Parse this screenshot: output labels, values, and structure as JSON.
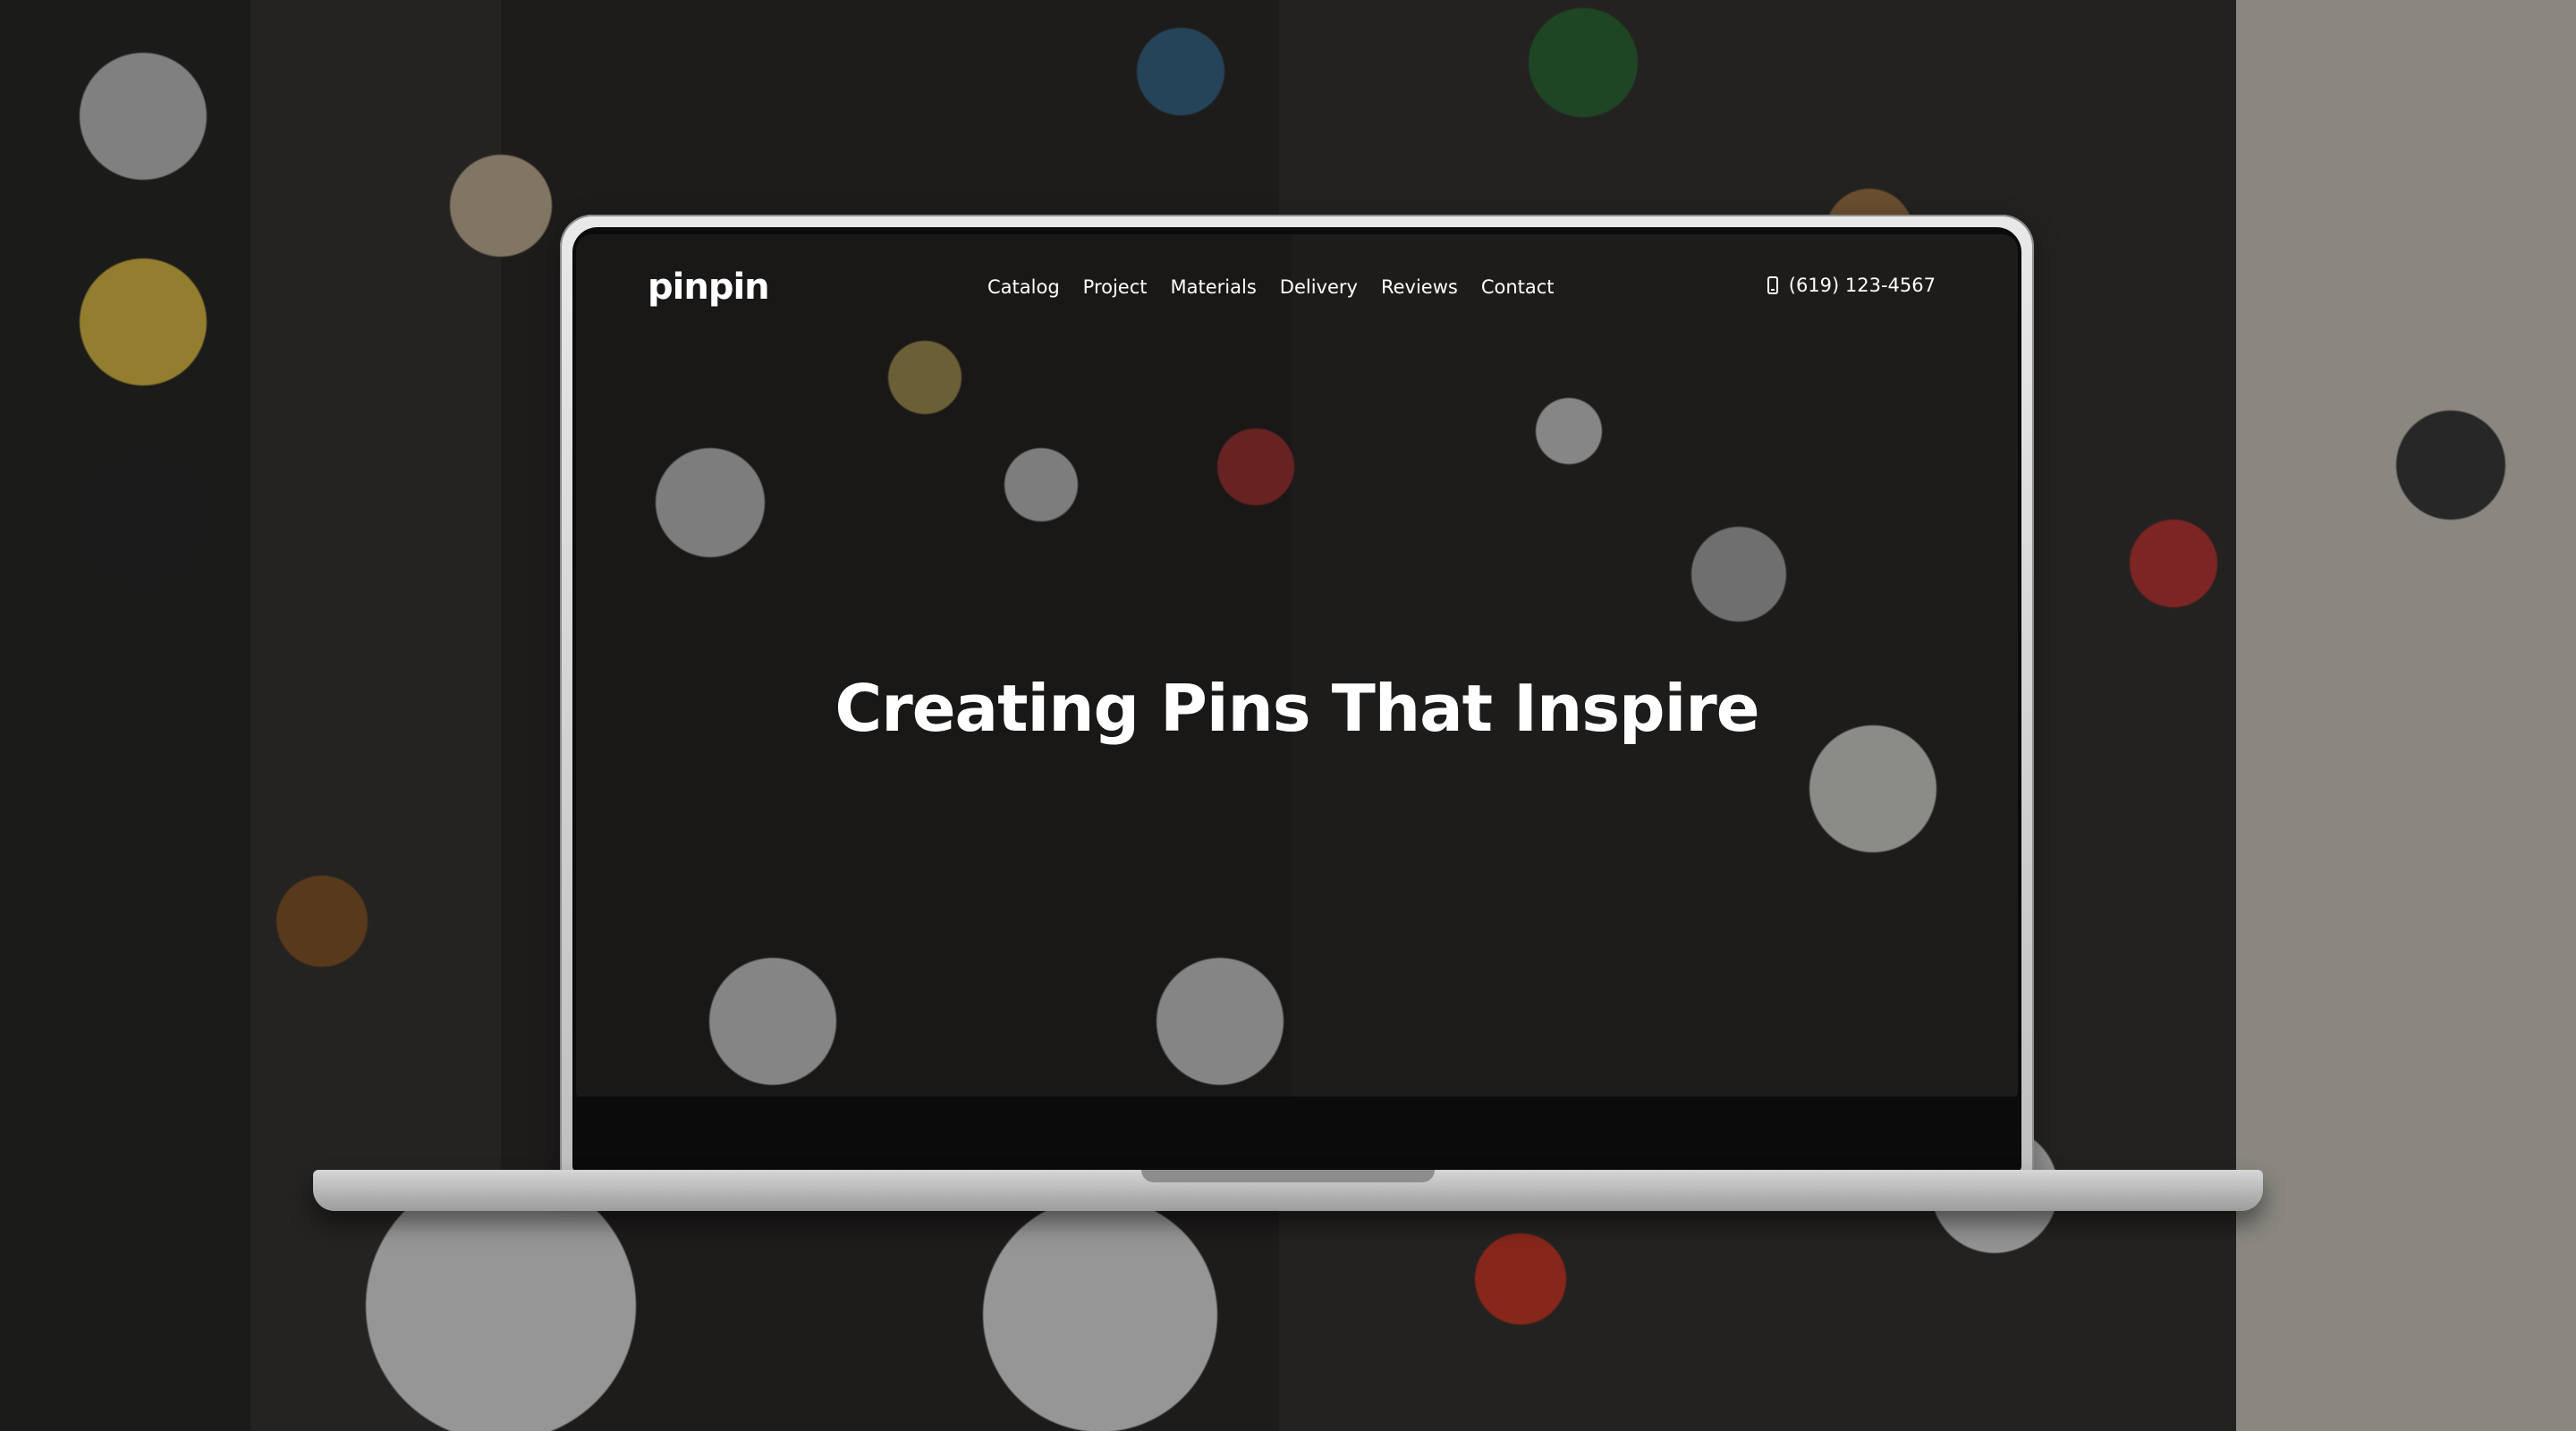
{
  "brand": {
    "logo_text": "pinpin"
  },
  "nav": {
    "items": [
      {
        "label": "Catalog"
      },
      {
        "label": "Project"
      },
      {
        "label": "Materials"
      },
      {
        "label": "Delivery"
      },
      {
        "label": "Reviews"
      },
      {
        "label": "Contact"
      }
    ]
  },
  "contact": {
    "phone": "(619) 123-4567",
    "phone_icon": "mobile-phone-icon"
  },
  "hero": {
    "title": "Creating Pins That Inspire"
  },
  "colors": {
    "text": "#ffffff",
    "overlay": "#000000"
  }
}
